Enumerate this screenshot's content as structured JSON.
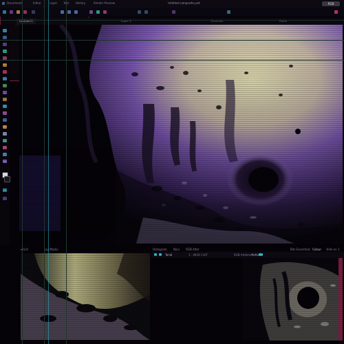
{
  "menubar": {
    "items": [
      "Documents",
      "Editor",
      "Layer",
      "Text",
      "History",
      "Render Preview"
    ],
    "window_title": "Untitled-composite.psd",
    "status_badge": "RGB"
  },
  "tabs": [
    {
      "label": "Untitled-1",
      "active": true
    },
    {
      "label": "Layer 1",
      "active": false
    },
    {
      "label": "Channels",
      "active": false
    },
    {
      "label": "Paths",
      "active": false
    }
  ],
  "bottom": {
    "left_panel": {
      "tab1": "▾ Grd",
      "tab2": "Lay Masks"
    },
    "right_header": {
      "tab1": "Histogram",
      "tab2": "Navi",
      "tab3": "RGB Alter"
    },
    "right_status": {
      "label1": "Bits Essentials",
      "value1": "Colour",
      "label2": "Hide ov 1"
    },
    "graph_toolbar": {
      "mode_label": "Tonal",
      "range_label": "1 · 4654 CLUT",
      "preset_label": "RGB Ambient",
      "preset_value": "Active"
    }
  },
  "colors": {
    "accent_cyan": "#2bb8c9",
    "accent_pink": "#c8306a",
    "accent_purple": "#7a52c8",
    "panel_border": "#7a1d3e"
  }
}
